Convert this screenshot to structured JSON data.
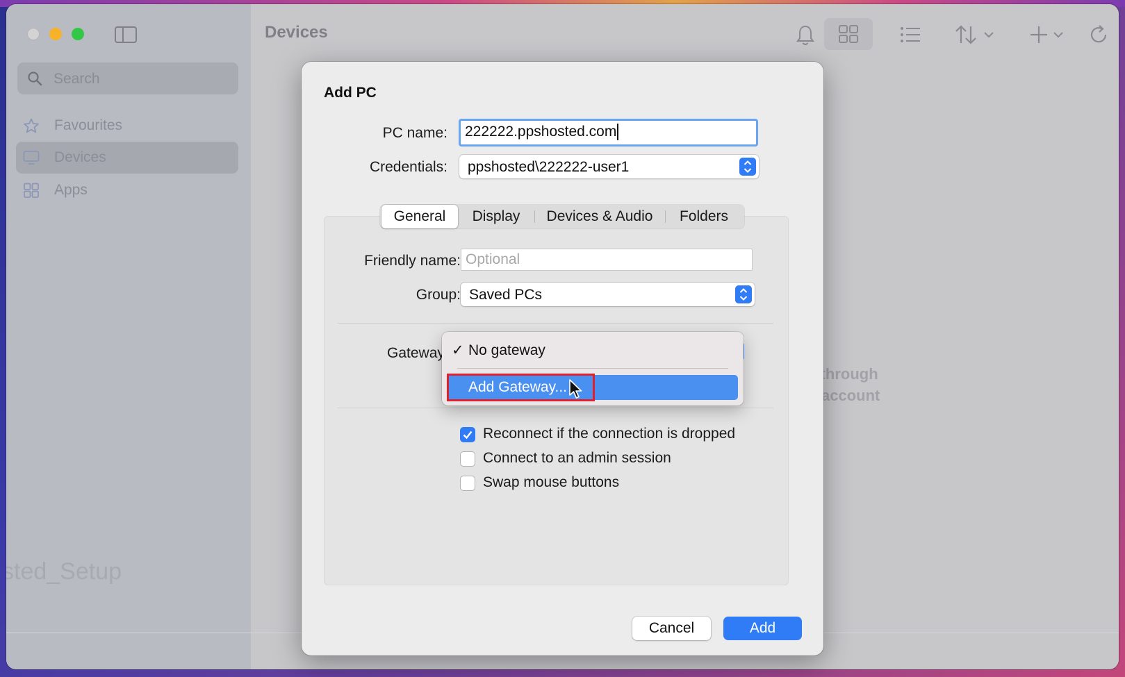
{
  "app": {
    "title": "Devices",
    "search_placeholder": "Search",
    "sidebar": [
      {
        "label": "Favourites",
        "icon": "star-icon"
      },
      {
        "label": "Devices",
        "icon": "monitor-icon",
        "selected": true
      },
      {
        "label": "Apps",
        "icon": "apps-grid-icon"
      }
    ],
    "background_fragment": "sted_Setup",
    "background_hint_line1": "u through",
    "background_hint_line2": "account"
  },
  "dialog": {
    "title": "Add PC",
    "pc_name_label": "PC name:",
    "pc_name_value": "222222.ppshosted.com",
    "credentials_label": "Credentials:",
    "credentials_value": "ppshosted\\222222-user1",
    "tabs": [
      "General",
      "Display",
      "Devices & Audio",
      "Folders"
    ],
    "selected_tab": "General",
    "friendly_name_label": "Friendly name:",
    "friendly_name_placeholder": "Optional",
    "group_label": "Group:",
    "group_value": "Saved PCs",
    "gateway_label": "Gateway",
    "gateway_menu": {
      "checked_item": "No gateway",
      "highlighted_item": "Add Gateway..."
    },
    "options": [
      {
        "label": "Reconnect if the connection is dropped",
        "checked": true
      },
      {
        "label": "Connect to an admin session",
        "checked": false
      },
      {
        "label": "Swap mouse buttons",
        "checked": false
      }
    ],
    "cancel_label": "Cancel",
    "add_label": "Add"
  },
  "colors": {
    "accent": "#2f7cf6",
    "menu_highlight": "#4a90f0",
    "annotation_red": "#e0202a"
  }
}
